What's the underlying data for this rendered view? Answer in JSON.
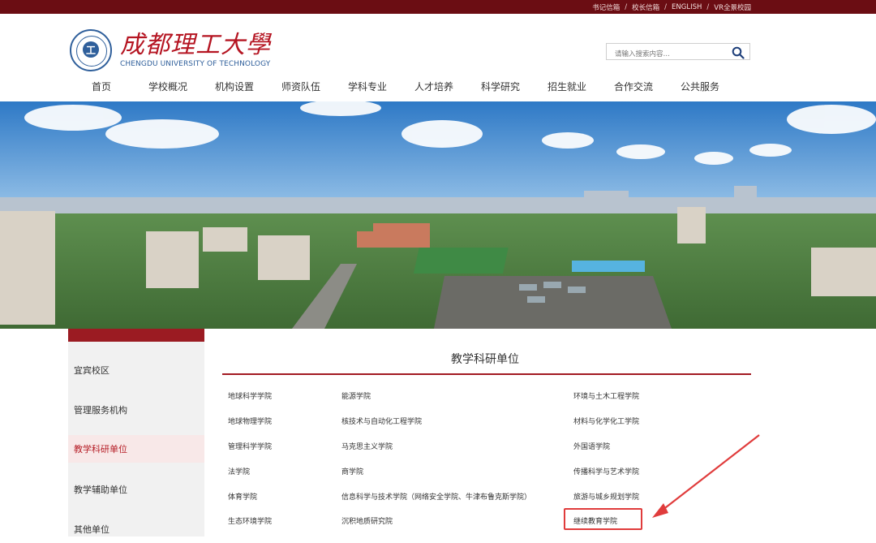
{
  "topbar": {
    "links": [
      "书记信箱",
      "校长信箱",
      "ENGLISH",
      "VR全景校园"
    ],
    "separator": "/"
  },
  "logo": {
    "seal_mark": "工",
    "seal_text": "成都理工大学",
    "name_cn": "成都理工大學",
    "name_en": "CHENGDU UNIVERSITY OF TECHNOLOGY"
  },
  "search": {
    "placeholder": "请输入搜索内容…",
    "icon": "search-icon"
  },
  "nav": {
    "items": [
      "首页",
      "学校概况",
      "机构设置",
      "师资队伍",
      "学科专业",
      "人才培养",
      "科学研究",
      "招生就业",
      "合作交流",
      "公共服务"
    ]
  },
  "sidebar": {
    "items": [
      "宜宾校区",
      "管理服务机构",
      "教学科研单位",
      "教学辅助单位",
      "其他单位"
    ],
    "active_index": 2
  },
  "main": {
    "title": "教学科研单位",
    "col1": [
      "地球科学学院",
      "地球物理学院",
      "管理科学学院",
      "法学院",
      "体育学院",
      "生态环境学院"
    ],
    "col2": [
      "能源学院",
      "核技术与自动化工程学院",
      "马克思主义学院",
      "商学院",
      "信息科学与技术学院（网络安全学院、牛津布鲁克斯学院）",
      "沉积地质研究院"
    ],
    "col3": [
      "环境与土木工程学院",
      "材料与化学化工学院",
      "外国语学院",
      "传播科学与艺术学院",
      "旅游与城乡规划学院",
      "继续教育学院"
    ]
  },
  "colors": {
    "topbar": "#6b0d13",
    "accent": "#a21a22",
    "annotation": "#e03c3c"
  }
}
